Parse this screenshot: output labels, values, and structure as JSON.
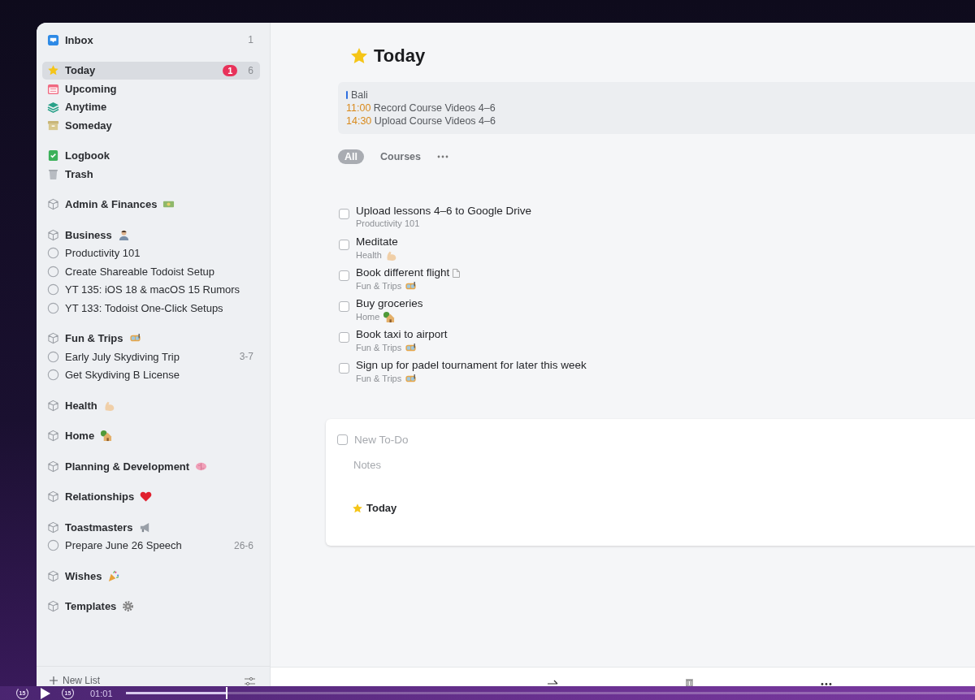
{
  "sidebar": {
    "inbox": {
      "label": "Inbox",
      "count": "1",
      "selected": false
    },
    "lists": [
      {
        "label": "Today",
        "badge": "1",
        "count": "6",
        "selected": true
      },
      {
        "label": "Upcoming",
        "selected": false
      },
      {
        "label": "Anytime",
        "selected": false
      },
      {
        "label": "Someday",
        "selected": false
      }
    ],
    "archive": [
      {
        "label": "Logbook",
        "selected": false
      },
      {
        "label": "Trash",
        "selected": false
      }
    ],
    "areas": [
      {
        "name": "Admin & Finances"
      },
      {
        "name": "Business",
        "projects": [
          {
            "name": "Productivity 101"
          },
          {
            "name": "Create Shareable Todoist Setup"
          },
          {
            "name": "YT 135: iOS 18 & macOS 15 Rumors"
          },
          {
            "name": "YT 133: Todoist One-Click Setups"
          }
        ]
      },
      {
        "name": "Fun & Trips",
        "projects": [
          {
            "name": "Early July Skydiving Trip",
            "date": "3-7"
          },
          {
            "name": "Get Skydiving B License"
          }
        ]
      },
      {
        "name": "Health"
      },
      {
        "name": "Home"
      },
      {
        "name": "Planning & Development"
      },
      {
        "name": "Relationships"
      },
      {
        "name": "Toastmasters",
        "projects": [
          {
            "name": "Prepare June 26 Speech",
            "date": "26-6"
          }
        ]
      },
      {
        "name": "Wishes"
      },
      {
        "name": "Templates"
      }
    ],
    "footer": {
      "label": "New List"
    }
  },
  "main": {
    "title": "Today",
    "calendar": {
      "name": "Bali",
      "color": "#2f6fe0",
      "events": [
        {
          "time": "11:00",
          "title": "Record Course Videos 4–6"
        },
        {
          "time": "14:30",
          "title": "Upload Course Videos 4–6"
        }
      ]
    },
    "tags": [
      {
        "label": "All",
        "selected": true
      },
      {
        "label": "Courses",
        "selected": false
      }
    ],
    "tasks": [
      {
        "title": "Upload lessons 4–6 to Google Drive",
        "project": "Productivity 101",
        "checked": false,
        "notes": false
      },
      {
        "title": "Meditate",
        "project": "Health",
        "checked": false,
        "notes": false
      },
      {
        "title": "Book different flight",
        "project": "Fun & Trips",
        "checked": false,
        "notes": true
      },
      {
        "title": "Buy groceries",
        "project": "Home",
        "checked": false,
        "notes": false
      },
      {
        "title": "Book taxi to airport",
        "project": "Fun & Trips",
        "checked": false,
        "notes": false
      },
      {
        "title": "Sign up for padel tournament for later this week",
        "project": "Fun & Trips",
        "checked": false,
        "notes": false
      }
    ],
    "new_todo": {
      "placeholder": "New To-Do",
      "notes_placeholder": "Notes",
      "when": "Today",
      "checked": false
    }
  },
  "player": {
    "skip_back": "15",
    "skip_forward": "15",
    "time": "01:01",
    "level": 0.12
  }
}
